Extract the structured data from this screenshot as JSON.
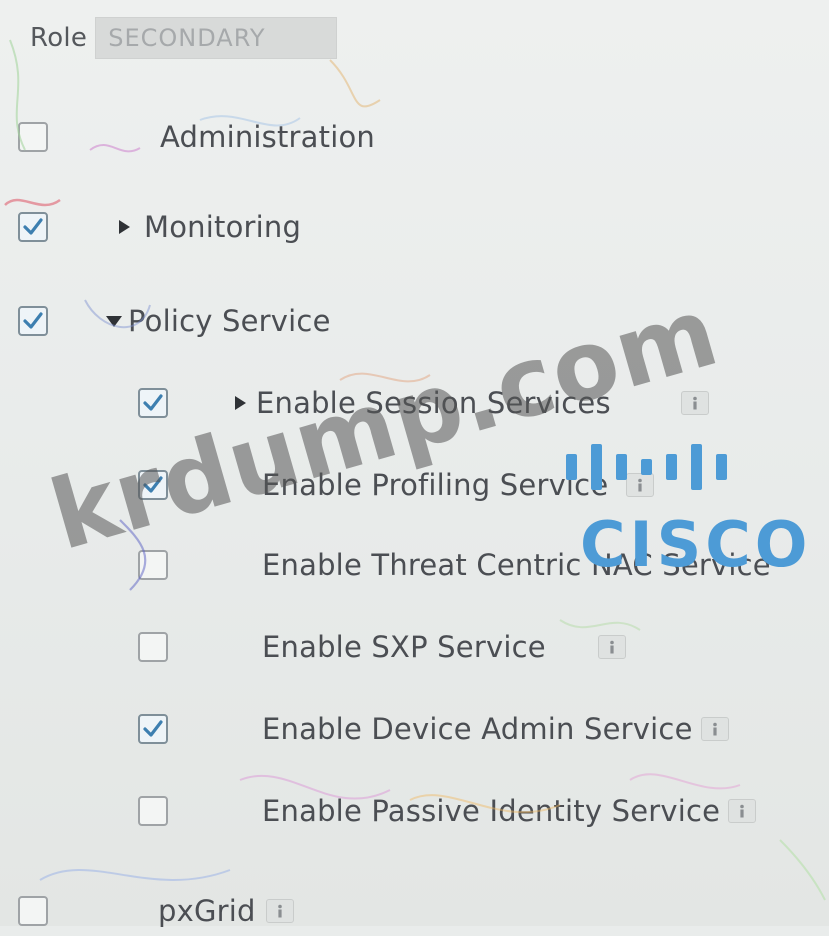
{
  "role": {
    "label": "Role",
    "value": "SECONDARY"
  },
  "tree": {
    "administration": {
      "label": "Administration",
      "checked": false
    },
    "monitoring": {
      "label": "Monitoring",
      "checked": true,
      "expanded": false
    },
    "policy_service": {
      "label": "Policy Service",
      "checked": true,
      "expanded": true
    },
    "session_services": {
      "label": "Enable Session Services",
      "checked": true,
      "expanded": false
    },
    "profiling_service": {
      "label": "Enable Profiling Service",
      "checked": true
    },
    "threat_centric": {
      "label": "Enable Threat Centric NAC Service",
      "checked": false
    },
    "sxp_service": {
      "label": "Enable SXP Service",
      "checked": false
    },
    "device_admin": {
      "label": "Enable Device Admin Service",
      "checked": true
    },
    "passive_identity": {
      "label": "Enable Passive Identity Service",
      "checked": false
    },
    "pxgrid": {
      "label": "pxGrid",
      "checked": false
    }
  },
  "watermark": {
    "text": "krdump.com"
  },
  "logo": {
    "text": "CISCO"
  },
  "colors": {
    "accent_blue": "#4d9bd6",
    "checkbox_border": "#9fa3a6",
    "check_mark": "#3d7fb0"
  }
}
